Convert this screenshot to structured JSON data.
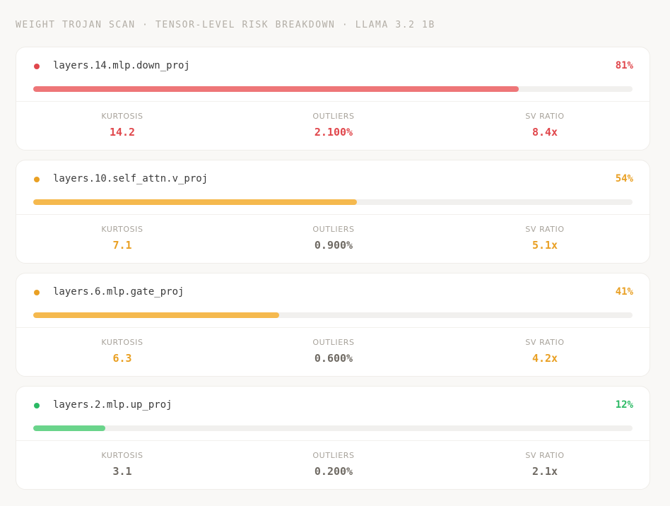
{
  "header": {
    "title": "WEIGHT TROJAN SCAN · TENSOR-LEVEL RISK BREAKDOWN · LLAMA 3.2 1B"
  },
  "metric_labels": {
    "kurtosis": "KURTOSIS",
    "outliers": "OUTLIERS",
    "sv_ratio": "SV RATIO"
  },
  "colors": {
    "high_text": "#e0474c",
    "high_dot": "#e0474c",
    "high_bar": "#ee7678",
    "medium_text": "#e9a024",
    "medium_dot": "#e9a024",
    "medium_bar": "#f5b94e",
    "low_text": "#2bb964",
    "low_dot": "#2bb964",
    "low_bar": "#6ad48b",
    "neutral_value": "#6f6a63"
  },
  "tensors": [
    {
      "name": "layers.14.mlp.down_proj",
      "risk_percent": "81%",
      "risk_level": 0.81,
      "severity": "high",
      "kurtosis": "14.2",
      "kurtosis_flag": "high",
      "outliers": "2.100%",
      "outliers_flag": "high",
      "sv_ratio": "8.4x",
      "sv_ratio_flag": "high"
    },
    {
      "name": "layers.10.self_attn.v_proj",
      "risk_percent": "54%",
      "risk_level": 0.54,
      "severity": "medium",
      "kurtosis": "7.1",
      "kurtosis_flag": "medium",
      "outliers": "0.900%",
      "outliers_flag": "neutral",
      "sv_ratio": "5.1x",
      "sv_ratio_flag": "medium"
    },
    {
      "name": "layers.6.mlp.gate_proj",
      "risk_percent": "41%",
      "risk_level": 0.41,
      "severity": "medium",
      "kurtosis": "6.3",
      "kurtosis_flag": "medium",
      "outliers": "0.600%",
      "outliers_flag": "neutral",
      "sv_ratio": "4.2x",
      "sv_ratio_flag": "medium"
    },
    {
      "name": "layers.2.mlp.up_proj",
      "risk_percent": "12%",
      "risk_level": 0.12,
      "severity": "low",
      "kurtosis": "3.1",
      "kurtosis_flag": "neutral",
      "outliers": "0.200%",
      "outliers_flag": "neutral",
      "sv_ratio": "2.1x",
      "sv_ratio_flag": "neutral"
    }
  ]
}
